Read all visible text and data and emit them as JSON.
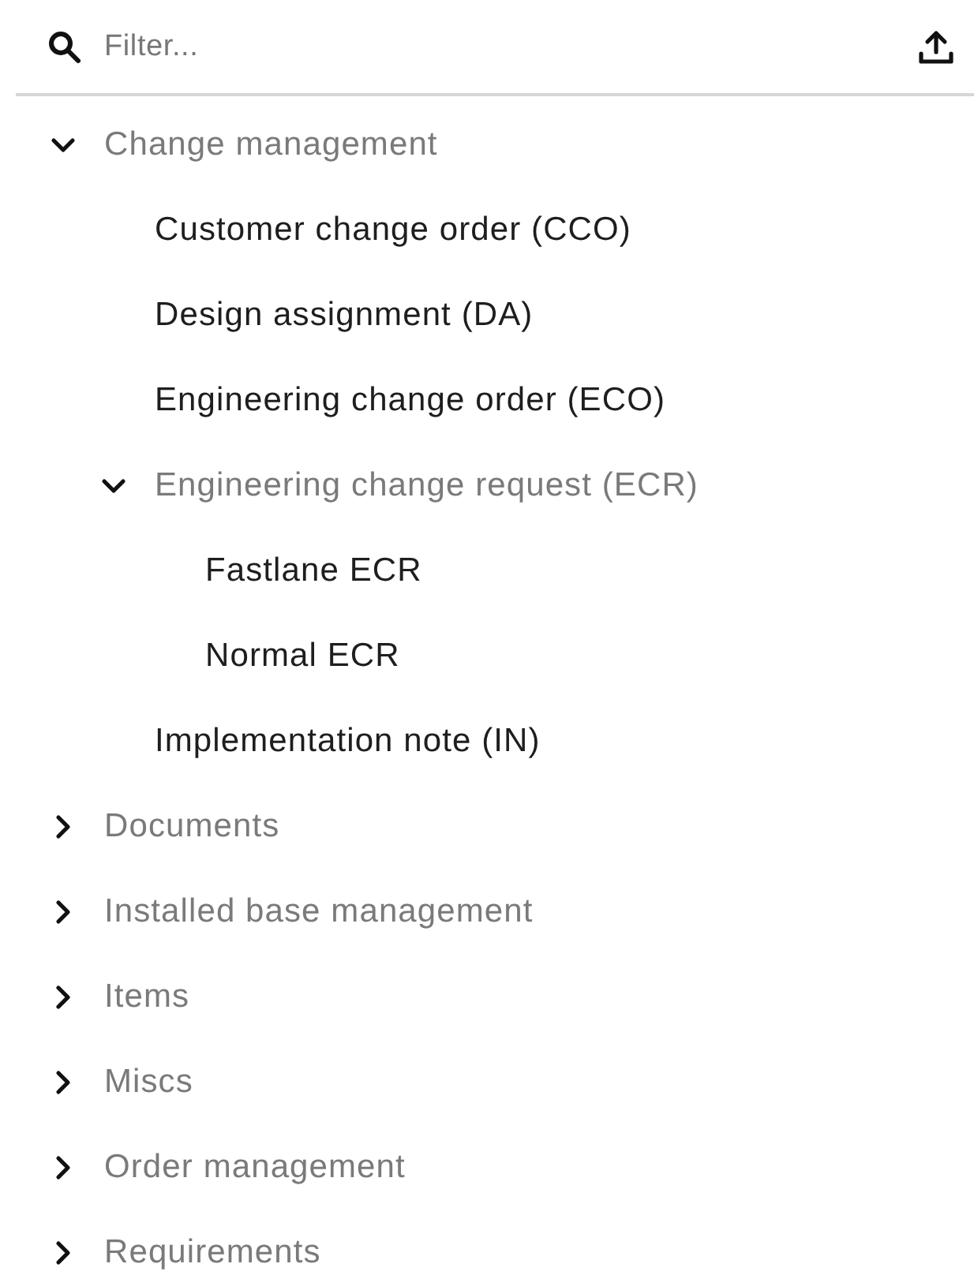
{
  "filter": {
    "placeholder": "Filter..."
  },
  "tree": [
    {
      "kind": "group",
      "label": "Change management",
      "expanded": true,
      "children": [
        {
          "kind": "item",
          "label": "Customer change order (CCO)"
        },
        {
          "kind": "item",
          "label": "Design assignment (DA)"
        },
        {
          "kind": "item",
          "label": "Engineering change order (ECO)"
        },
        {
          "kind": "group",
          "label": "Engineering change request (ECR)",
          "expanded": true,
          "children": [
            {
              "kind": "item",
              "label": "Fastlane ECR"
            },
            {
              "kind": "item",
              "label": "Normal ECR"
            }
          ]
        },
        {
          "kind": "item",
          "label": "Implementation note (IN)"
        }
      ]
    },
    {
      "kind": "group",
      "label": "Documents",
      "expanded": false
    },
    {
      "kind": "group",
      "label": "Installed base management",
      "expanded": false
    },
    {
      "kind": "group",
      "label": "Items",
      "expanded": false
    },
    {
      "kind": "group",
      "label": "Miscs",
      "expanded": false
    },
    {
      "kind": "group",
      "label": "Order management",
      "expanded": false
    },
    {
      "kind": "group",
      "label": "Requirements",
      "expanded": false
    }
  ]
}
